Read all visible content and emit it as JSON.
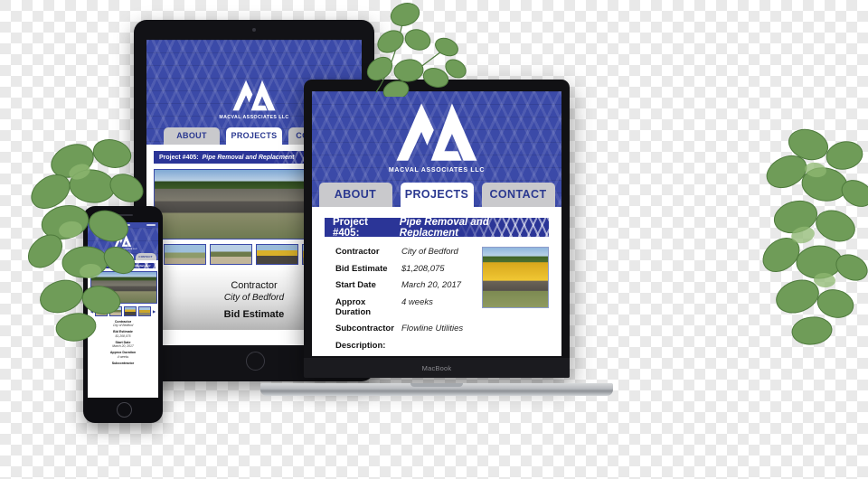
{
  "brand": {
    "name": "MACVAL ASSOCIATES LLC",
    "logo_icon": "macval-ma-monogram",
    "primary_color": "#3b4aa8",
    "banner_color": "#2b3597",
    "tab_text_color": "#2b3990"
  },
  "nav": {
    "tabs": [
      {
        "label": "ABOUT",
        "active": false
      },
      {
        "label": "PROJECTS",
        "active": true
      },
      {
        "label": "CONTACT",
        "active": false
      }
    ]
  },
  "project": {
    "number_label": "Project #405:",
    "title": "Pipe Removal and Replacment",
    "details": [
      {
        "label": "Contractor",
        "value": "City of Bedford"
      },
      {
        "label": "Bid Estimate",
        "value": "$1,208,075"
      },
      {
        "label": "Start Date",
        "value": "March 20, 2017"
      },
      {
        "label": "Approx Duration",
        "value": "4 weeks"
      },
      {
        "label": "Subcontractor",
        "value": "Flowline Utilities"
      }
    ],
    "description_label": "Description:",
    "hero_photo_alt": "roadside-blue-pipe-photo",
    "inset_photo_alt": "yellow-excavator-photo",
    "thumbnails": [
      "construction-thumb-1",
      "construction-thumb-2",
      "construction-thumb-3",
      "construction-thumb-4"
    ],
    "gallery_prev_icon": "◀",
    "gallery_next_icon": "▶"
  },
  "devices": {
    "laptop": {
      "model_label": "MacBook"
    },
    "tablet": {
      "model_label": ""
    },
    "phone": {
      "model_label": ""
    }
  }
}
